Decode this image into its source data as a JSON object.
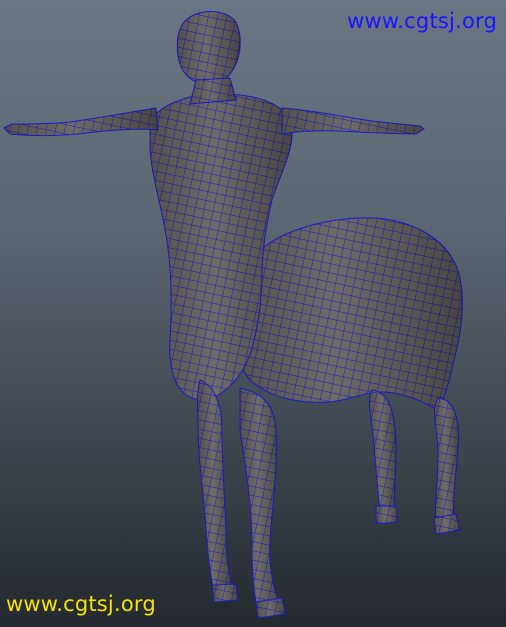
{
  "viewport": {
    "background_top": "#6a7683",
    "background_bottom": "#24292f"
  },
  "model": {
    "surface_color": "#6e6a66",
    "wireframe_color": "#1c1ccf"
  },
  "watermarks": {
    "top": {
      "text": "www.cgtsj.org",
      "color": "#1a14ff"
    },
    "bottom": {
      "text": "www.cgtsj.org",
      "color": "#f5e400"
    }
  }
}
